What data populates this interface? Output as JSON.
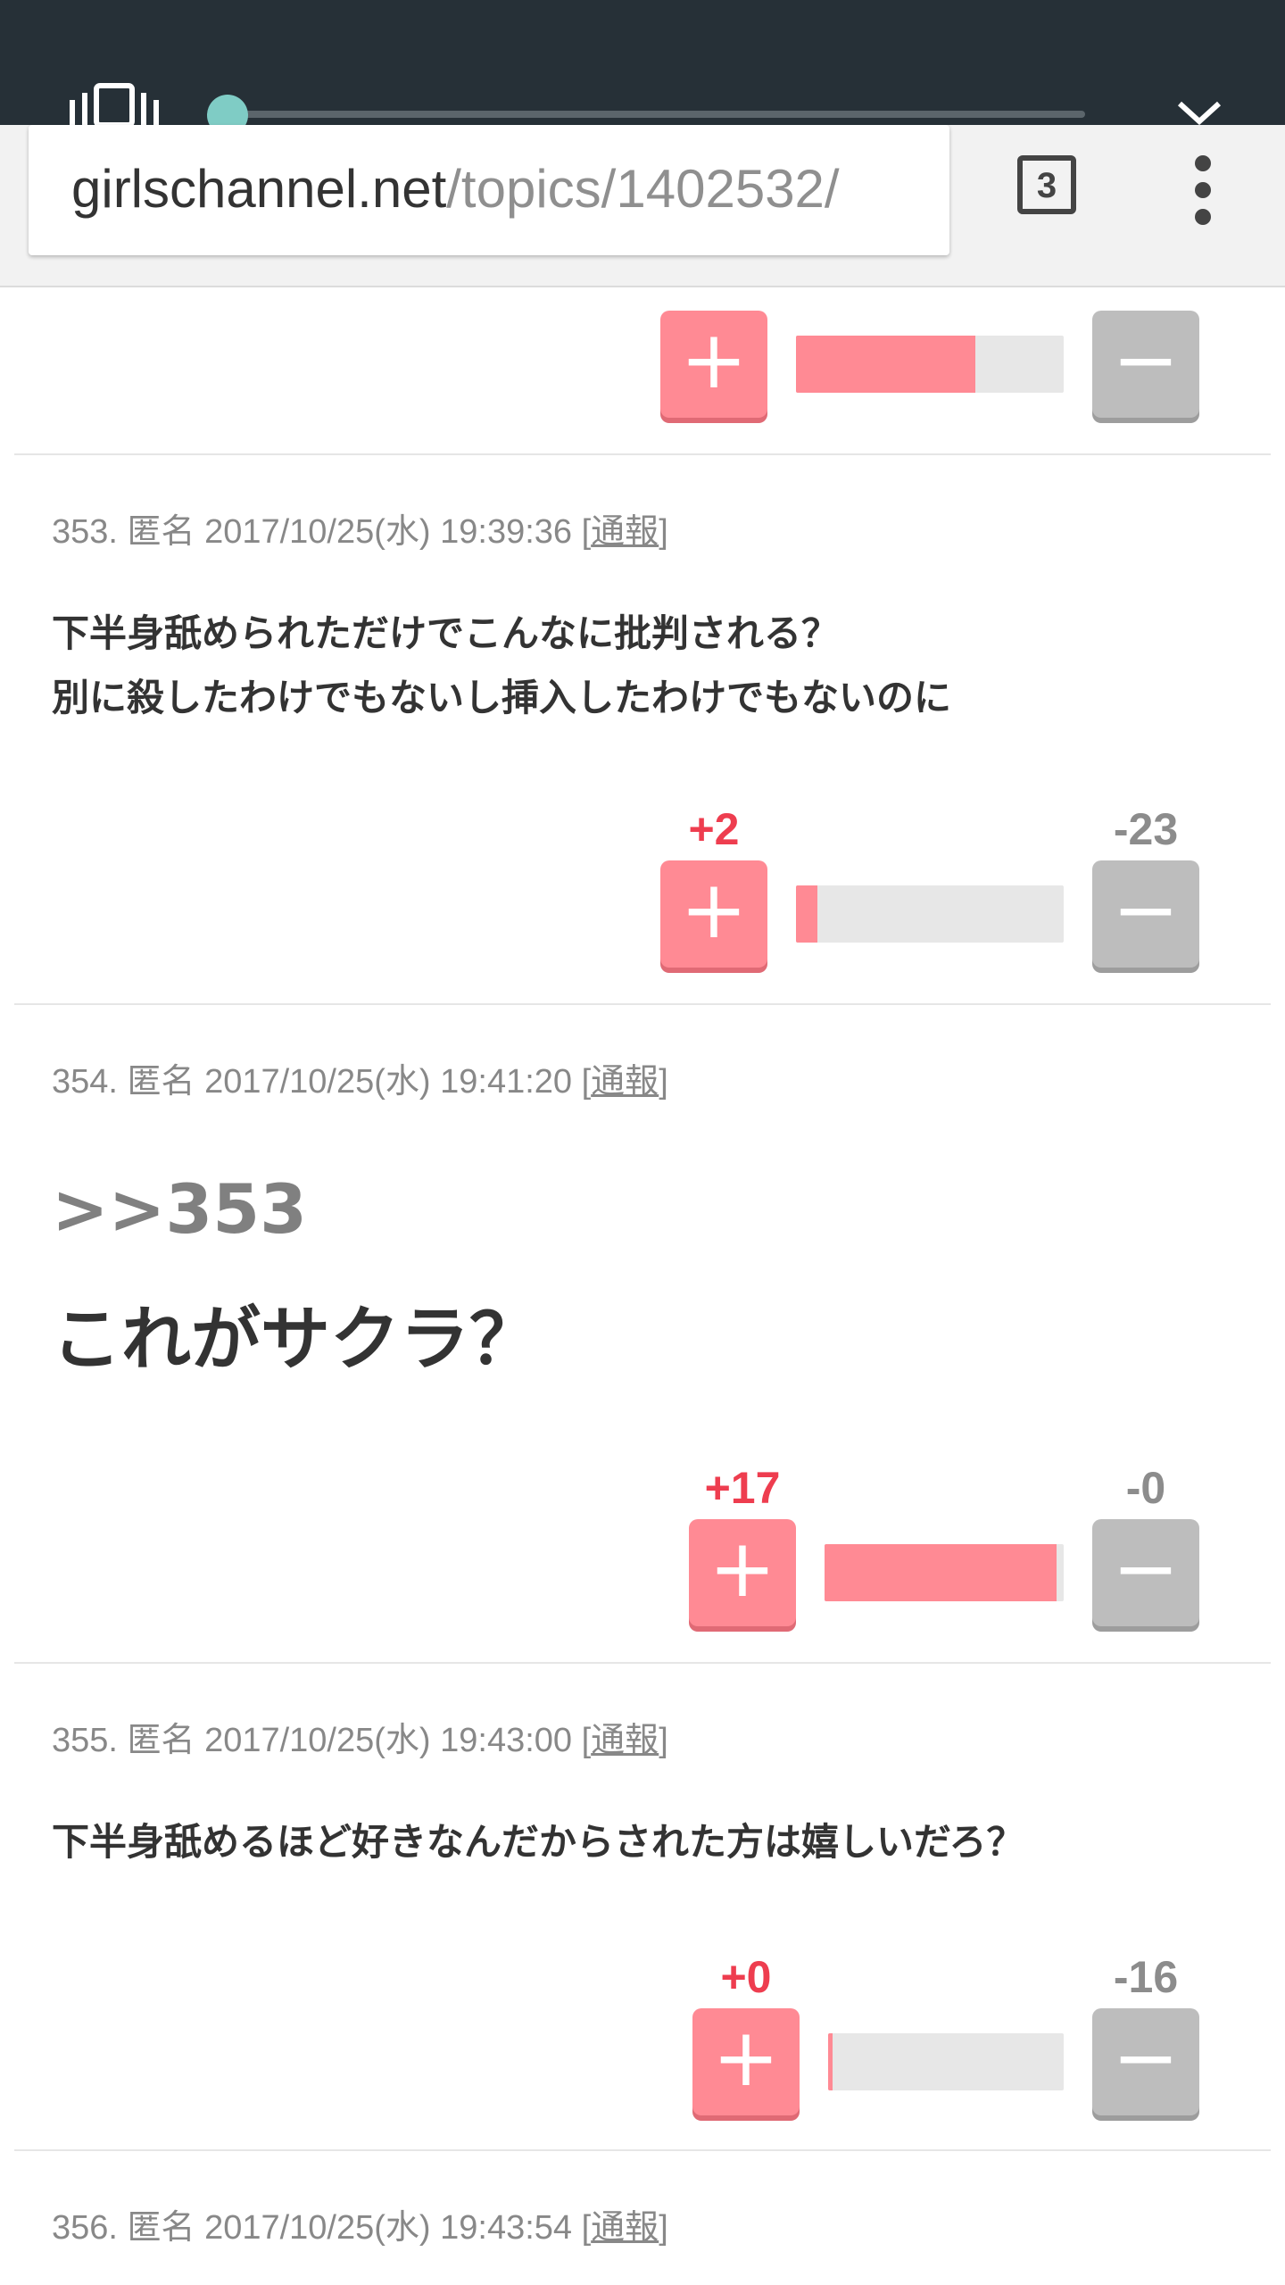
{
  "browser": {
    "url_domain": "girlschannel.net",
    "url_path": "/topics/1402532/",
    "tab_count": "3"
  },
  "colors": {
    "plus": "#ff8a94",
    "minus": "#bdbdbd",
    "plus_text": "#ee3d4f"
  },
  "comments": [
    {
      "number": "",
      "plus_label": "",
      "minus_label": "",
      "plus_ratio": 0.67
    },
    {
      "meta": "353. 匿名 2017/10/25(水) 19:39:36 [",
      "report": "通報",
      "meta_end": "]",
      "lines": [
        "下半身舐められただけでこんなに批判される？",
        "別に殺したわけでもないし挿入したわけでもないのに"
      ],
      "plus_label": "+2",
      "minus_label": "-23",
      "plus_ratio": 0.08
    },
    {
      "meta": "354. 匿名 2017/10/25(水) 19:41:20 [",
      "report": "通報",
      "meta_end": "]",
      "quote": ">>353",
      "big_text": "これがサクラ？",
      "plus_label": "+17",
      "minus_label": "-0",
      "plus_ratio": 0.97
    },
    {
      "meta": "355. 匿名 2017/10/25(水) 19:43:00 [",
      "report": "通報",
      "meta_end": "]",
      "lines": [
        "下半身舐めるほど好きなんだからされた方は嬉しいだろ？"
      ],
      "plus_label": "+0",
      "minus_label": "-16",
      "plus_ratio": 0.02
    },
    {
      "meta": "356. 匿名 2017/10/25(水) 19:43:54 [",
      "report": "通報",
      "meta_end": "]"
    }
  ],
  "icons": {
    "plus": "+",
    "minus": "−"
  }
}
